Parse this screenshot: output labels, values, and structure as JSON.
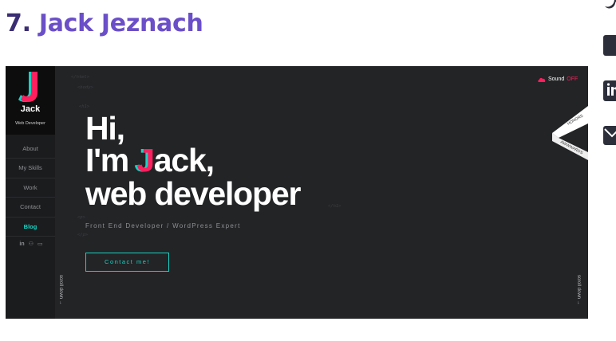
{
  "article": {
    "number": "7.",
    "name": "Jack Jeznach"
  },
  "share_icons": [
    "twitter-icon",
    "facebook-icon",
    "linkedin-icon",
    "email-icon"
  ],
  "site": {
    "logo": {
      "letter": "J",
      "name": "Jack",
      "role": "Web Developer"
    },
    "nav": [
      "About",
      "My Skills",
      "Work",
      "Contact",
      "Blog"
    ],
    "active_nav": "Blog",
    "social_icons": [
      "linkedin-icon",
      "github-icon",
      "codepen-icon"
    ],
    "social_glyphs": [
      "in",
      "⚇",
      "▭"
    ],
    "code_tags": {
      "html": "</html>",
      "body": "<body>",
      "h1_open": "<h1>",
      "h1_close": "</h1>",
      "p_open": "<p>",
      "p_close": "</p>"
    },
    "hero": {
      "line1": "Hi,",
      "line2_prefix": "I'm ",
      "line2_j": "J",
      "line2_rest": "ack,",
      "line3": "web developer"
    },
    "subtitle": "Front End Developer / WordPress Expert",
    "cta": "Contact me!",
    "sound": {
      "label": "Sound",
      "state": "OFF"
    },
    "scroll_label": "scroll down",
    "ribbon": {
      "top": "HONORS",
      "bottom": "AWWWARDS"
    },
    "colors": {
      "accent_pink": "#ff1f5e",
      "accent_teal": "#19d2c4",
      "heading_purple": "#6b4fc8",
      "background": "#222426"
    }
  }
}
